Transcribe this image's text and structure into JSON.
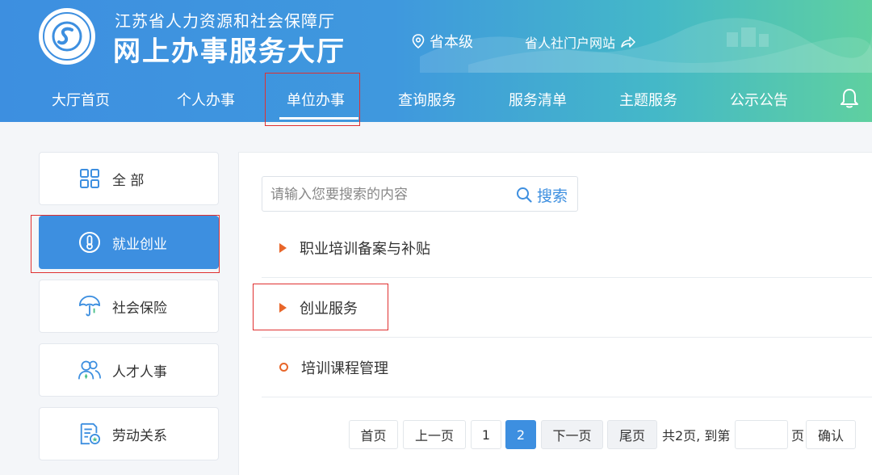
{
  "header": {
    "org_subtitle": "江苏省人力资源和社会保障厅",
    "org_title": "网上办事服务大厅",
    "location": "省本级",
    "portal_link": "省人社门户网站"
  },
  "nav": [
    {
      "label": "大厅首页"
    },
    {
      "label": "个人办事"
    },
    {
      "label": "单位办事"
    },
    {
      "label": "查询服务"
    },
    {
      "label": "服务清单"
    },
    {
      "label": "主题服务"
    },
    {
      "label": "公示公告"
    }
  ],
  "sidebar": [
    {
      "label": "全 部",
      "icon": "grid-icon"
    },
    {
      "label": "就业创业",
      "icon": "thermometer-icon"
    },
    {
      "label": "社会保险",
      "icon": "umbrella-icon"
    },
    {
      "label": "人才人事",
      "icon": "people-icon"
    },
    {
      "label": "劳动关系",
      "icon": "document-badge-icon"
    }
  ],
  "search": {
    "placeholder": "请输入您要搜索的内容",
    "button_label": "搜索"
  },
  "items": [
    {
      "label": "职业培训备案与补贴"
    },
    {
      "label": "创业服务"
    },
    {
      "label": "培训课程管理"
    }
  ],
  "pagination": {
    "first": "首页",
    "prev": "上一页",
    "pages": [
      "1",
      "2"
    ],
    "current": "2",
    "next": "下一页",
    "last": "尾页",
    "summary": "共2页, 到第",
    "page_unit": "页",
    "confirm": "确认"
  },
  "colors": {
    "primary": "#3d8fe0",
    "accent": "#e8662a",
    "highlight": "#e03030"
  }
}
